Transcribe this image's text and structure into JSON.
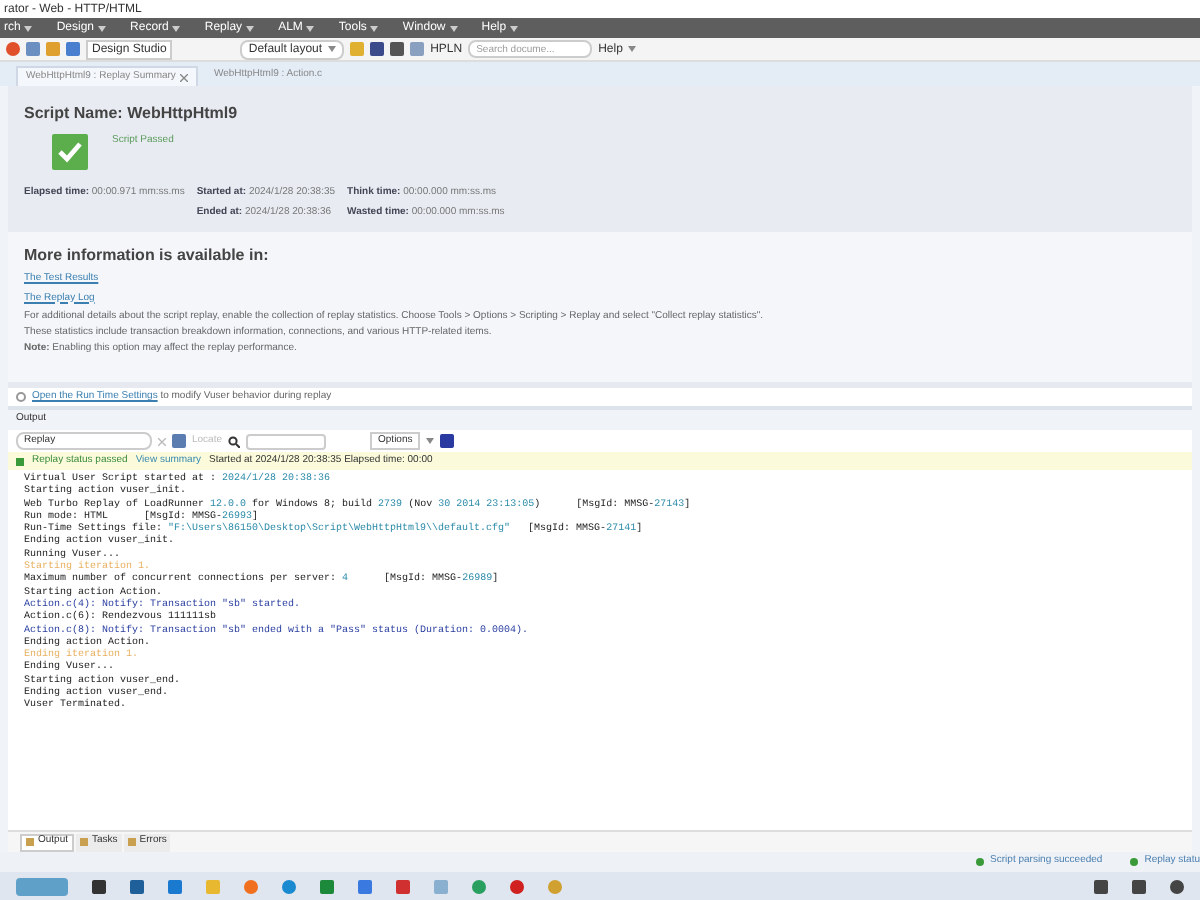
{
  "window": {
    "title": "rator - Web - HTTP/HTML"
  },
  "menu": [
    "rch",
    "Design",
    "Record",
    "Replay",
    "ALM",
    "Tools",
    "Window",
    "Help"
  ],
  "toolbar": {
    "design_studio": "Design Studio",
    "layout": "Default layout",
    "hpln": "HPLN",
    "search": {
      "placeholder": "Search docume..."
    },
    "help": "Help"
  },
  "tabs": [
    {
      "label": "WebHttpHtml9 : Replay Summary",
      "selected": true,
      "closable": true
    },
    {
      "label": "WebHttpHtml9 : Action.c",
      "selected": false,
      "closable": false
    }
  ],
  "summary": {
    "script_name_label": "Script Name:",
    "script_name": "WebHttpHtml9",
    "status": "Script Passed",
    "stats": [
      {
        "label": "Elapsed time:",
        "value": "00:00.971 mm:ss.ms"
      },
      {
        "label": "Started at:",
        "value": "2024/1/28 20:38:35"
      },
      {
        "label": "Think time:",
        "value": "00:00.000 mm:ss.ms"
      },
      {
        "label": "Ended at:",
        "value": "2024/1/28 20:38:36"
      },
      {
        "label": "Wasted time:",
        "value": "00:00.000 mm:ss.ms"
      }
    ],
    "more_title": "More information is available in:",
    "links": [
      "The Test Results",
      "The Replay Log"
    ],
    "details": [
      "For additional details about the script replay, enable the collection of replay statistics. Choose Tools > Options > Scripting > Replay and select \"Collect replay statistics\".",
      "These statistics include transaction breakdown information, connections, and various HTTP-related items.",
      "**Note:** Enabling this option may affect the replay performance."
    ],
    "runtime_link": "Open the Run Time Settings",
    "runtime_text": "to modify Vuser behavior during replay"
  },
  "output": {
    "title": "Output",
    "source": "Replay",
    "locate": "Locate",
    "options": "Options",
    "status": {
      "text": "Replay status passed",
      "link": "View summary",
      "info": "Started at 2024/1/28 20:38:35 Elapsed time: 00:00"
    },
    "log": [
      [
        {
          "text": "Virtual User Script started at : ",
          "kind": "plain"
        },
        {
          "text": "2024/1/28 20:38:36",
          "kind": "value"
        }
      ],
      [
        {
          "text": "Starting action vuser_init.",
          "kind": "plain"
        }
      ],
      [
        {
          "text": "Web Turbo Replay of LoadRunner ",
          "kind": "plain"
        },
        {
          "text": "12.0.0",
          "kind": "value"
        },
        {
          "text": " for Windows 8; build ",
          "kind": "plain"
        },
        {
          "text": "2739",
          "kind": "value"
        },
        {
          "text": " (Nov ",
          "kind": "plain"
        },
        {
          "text": "30 2014 23:13:05",
          "kind": "value"
        },
        {
          "text": ")      [MsgId: MMSG-",
          "kind": "plain"
        },
        {
          "text": "27143",
          "kind": "value"
        },
        {
          "text": "]",
          "kind": "plain"
        }
      ],
      [
        {
          "text": "Run mode: HTML      [MsgId: MMSG-",
          "kind": "plain"
        },
        {
          "text": "26993",
          "kind": "value"
        },
        {
          "text": "]",
          "kind": "plain"
        }
      ],
      [
        {
          "text": "Run-Time Settings file: ",
          "kind": "plain"
        },
        {
          "text": "\"F:\\Users\\86150\\Desktop\\Script\\WebHttpHtml9\\\\default.cfg\"",
          "kind": "value"
        },
        {
          "text": "   [MsgId: MMSG-",
          "kind": "plain"
        },
        {
          "text": "27141",
          "kind": "value"
        },
        {
          "text": "]",
          "kind": "plain"
        }
      ],
      [
        {
          "text": "Ending action vuser_init.",
          "kind": "plain"
        }
      ],
      [
        {
          "text": "Running Vuser...",
          "kind": "plain"
        }
      ],
      [
        {
          "text": "Starting iteration 1.",
          "kind": "iteration"
        }
      ],
      [
        {
          "text": "Maximum number of concurrent connections per server: ",
          "kind": "plain"
        },
        {
          "text": "4",
          "kind": "value"
        },
        {
          "text": "      [MsgId: MMSG-",
          "kind": "plain"
        },
        {
          "text": "26989",
          "kind": "value"
        },
        {
          "text": "]",
          "kind": "plain"
        }
      ],
      [
        {
          "text": "Starting action Action.",
          "kind": "plain"
        }
      ],
      [
        {
          "text": "Action.c(4): Notify: Transaction \"sb\" started.",
          "kind": "notify"
        }
      ],
      [
        {
          "text": "Action.c(6): Rendezvous 111111sb",
          "kind": "plain"
        }
      ],
      [
        {
          "text": "Action.c(8): Notify: Transaction \"sb\" ended with a \"Pass\" status (Duration: 0.0004).",
          "kind": "notify"
        }
      ],
      [
        {
          "text": "Ending action Action.",
          "kind": "plain"
        }
      ],
      [
        {
          "text": "Ending iteration 1.",
          "kind": "iteration"
        }
      ],
      [
        {
          "text": "Ending Vuser...",
          "kind": "plain"
        }
      ],
      [
        {
          "text": "Starting action vuser_end.",
          "kind": "plain"
        }
      ],
      [
        {
          "text": "Ending action vuser_end.",
          "kind": "plain"
        }
      ],
      [
        {
          "text": "Vuser Terminated.",
          "kind": "plain"
        }
      ]
    ],
    "bottom_tabs": [
      {
        "label": "Output",
        "selected": true
      },
      {
        "label": "Tasks",
        "selected": false
      },
      {
        "label": "Errors",
        "selected": false
      }
    ]
  },
  "status_bar": [
    "Script parsing succeeded",
    "Replay statu"
  ]
}
